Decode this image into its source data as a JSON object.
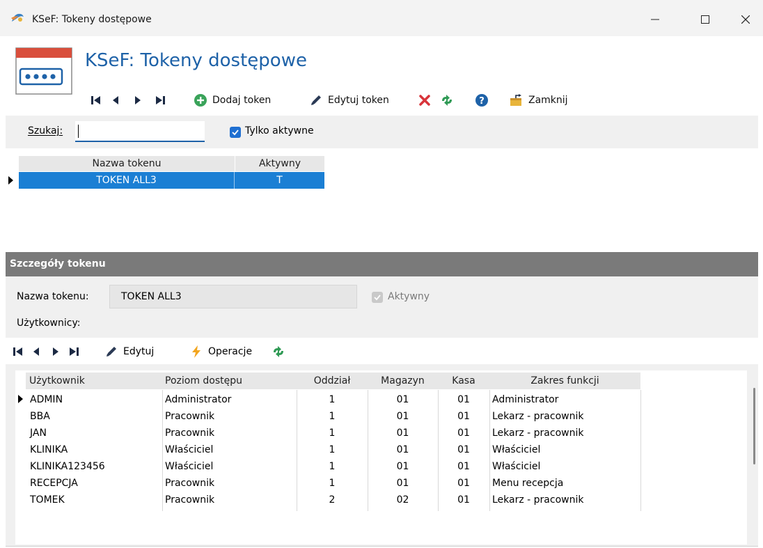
{
  "window": {
    "title": "KSeF: Tokeny dostępowe",
    "minimize_glyph": "—",
    "maximize_glyph": "☐",
    "close_glyph": "✕"
  },
  "header": {
    "title": "KSeF: Tokeny dostępowe",
    "icon": "form-password-icon"
  },
  "toolbar": {
    "add_label": "Dodaj token",
    "edit_label": "Edytuj token",
    "close_label": "Zamknij",
    "icons": [
      "first-record-icon",
      "prev-record-icon",
      "next-record-icon",
      "last-record-icon",
      "add-icon",
      "pencil-icon",
      "delete-icon",
      "refresh-icon",
      "help-icon",
      "exit-icon"
    ]
  },
  "search": {
    "label": "Szukaj:",
    "value": "",
    "only_active_label": "Tylko aktywne",
    "only_active_checked": true
  },
  "token_grid": {
    "columns": [
      "Nazwa tokenu",
      "Aktywny"
    ],
    "rows": [
      {
        "name": "TOKEN ALL3",
        "active": "T",
        "selected": true
      }
    ]
  },
  "details": {
    "header": "Szczegóły tokenu",
    "token_name_label": "Nazwa tokenu:",
    "token_name_value": "TOKEN ALL3",
    "active_label": "Aktywny",
    "active_checked": true,
    "users_label": "Użytkownicy:"
  },
  "users_toolbar": {
    "edit_label": "Edytuj",
    "operations_label": "Operacje"
  },
  "users_grid": {
    "columns": [
      "Użytkownik",
      "Poziom dostępu",
      "Oddział",
      "Magazyn",
      "Kasa",
      "Zakres funkcji"
    ],
    "rows": [
      [
        "ADMIN",
        "Administrator",
        "1",
        "01",
        "01",
        "Administrator"
      ],
      [
        "BBA",
        "Pracownik",
        "1",
        "01",
        "01",
        "Lekarz - pracownik"
      ],
      [
        "JAN",
        "Pracownik",
        "1",
        "01",
        "01",
        "Lekarz - pracownik"
      ],
      [
        "KLINIKA",
        "Właściciel",
        "1",
        "01",
        "01",
        "Właściciel"
      ],
      [
        "KLINIKA123456",
        "Właściciel",
        "1",
        "01",
        "01",
        "Właściciel"
      ],
      [
        "RECEPCJA",
        "Pracownik",
        "1",
        "01",
        "01",
        "Menu recepcja"
      ],
      [
        "TOMEK",
        "Pracownik",
        "2",
        "02",
        "01",
        "Lekarz - pracownik"
      ]
    ]
  },
  "colors": {
    "accent": "#1e62a8",
    "selection": "#1b7fd4",
    "section_header": "#7a7a7a"
  }
}
